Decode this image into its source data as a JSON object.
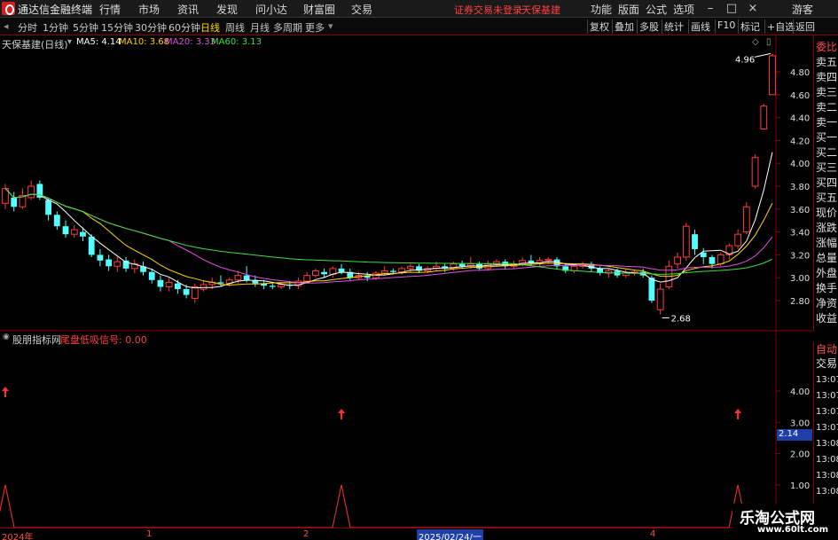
{
  "titlebar": {
    "app_title": "通达信金融终端",
    "menu": [
      "行情",
      "市场",
      "资讯",
      "发现",
      "问小达",
      "财富圈",
      "交易"
    ],
    "warning": "证券交易未登录",
    "stock_name": "天保基建",
    "right_menu": [
      "功能",
      "版面",
      "公式",
      "选项"
    ],
    "user": "游客",
    "min_icon": "minimize-icon",
    "max_icon": "maximize-icon",
    "close_icon": "close-icon"
  },
  "periodbar": {
    "periods": [
      "分时",
      "1分钟",
      "5分钟",
      "15分钟",
      "30分钟",
      "60分钟",
      "日线",
      "周线",
      "月线",
      "多周期",
      "更多"
    ],
    "active": "日线",
    "tools": [
      "复权",
      "叠加",
      "多股",
      "统计",
      "画线",
      "F10",
      "标记",
      "+自选",
      "返回"
    ]
  },
  "main_chart": {
    "header_name": "天保基建",
    "header_period": "(日线)",
    "ma": [
      {
        "label": "MA5: 4.14",
        "color": "#ffffff"
      },
      {
        "label": "MA10: 3.68",
        "color": "#ffd700"
      },
      {
        "label": "MA20: 3.33",
        "color": "#e050e0"
      },
      {
        "label": "MA60: 3.13",
        "color": "#40e040"
      }
    ],
    "high_label": "4.96",
    "low_label": "2.68",
    "y_ticks": [
      "4.80",
      "4.60",
      "4.40",
      "4.20",
      "4.00",
      "3.80",
      "3.60",
      "3.40",
      "3.20",
      "3.00",
      "2.80"
    ]
  },
  "indicator": {
    "name": "股朋指标网",
    "signal_label": "尾盘低吸信号: 0.00",
    "value_badge": "2.14",
    "y_ticks": [
      "4.00",
      "3.00",
      "2.00",
      "1.00"
    ]
  },
  "side_panel": {
    "rows": [
      "委比",
      "卖五",
      "卖四",
      "卖三",
      "卖二",
      "卖一",
      "买一",
      "买二",
      "买三",
      "买四",
      "买五",
      "现价",
      "涨跌",
      "涨幅",
      "总量",
      "外盘",
      "换手",
      "净资",
      "收益"
    ],
    "bottom_rows": [
      "自动",
      "交易"
    ],
    "times": [
      "13:07",
      "13:07",
      "13:07",
      "13:07",
      "13:08",
      "13:08",
      "13:08",
      "13:08",
      "13:08"
    ],
    "top_label": "委比"
  },
  "timebar": {
    "ticks": [
      "2024年",
      "1",
      "2",
      "2025/02/24/一",
      "4"
    ]
  },
  "watermark": {
    "text": "乐淘公式网",
    "url": "www.60lt.com"
  },
  "chart_data": {
    "type": "candlestick",
    "title": "天保基建 (日线)",
    "ylim": [
      2.6,
      5.0
    ],
    "candles": [
      {
        "o": 3.65,
        "c": 3.78,
        "h": 3.82,
        "l": 3.6
      },
      {
        "o": 3.7,
        "c": 3.62,
        "h": 3.75,
        "l": 3.58
      },
      {
        "o": 3.62,
        "c": 3.72,
        "h": 3.78,
        "l": 3.6
      },
      {
        "o": 3.7,
        "c": 3.8,
        "h": 3.85,
        "l": 3.68
      },
      {
        "o": 3.82,
        "c": 3.7,
        "h": 3.85,
        "l": 3.68
      },
      {
        "o": 3.68,
        "c": 3.55,
        "h": 3.7,
        "l": 3.5
      },
      {
        "o": 3.55,
        "c": 3.45,
        "h": 3.58,
        "l": 3.42
      },
      {
        "o": 3.45,
        "c": 3.38,
        "h": 3.5,
        "l": 3.35
      },
      {
        "o": 3.38,
        "c": 3.42,
        "h": 3.46,
        "l": 3.35
      },
      {
        "o": 3.4,
        "c": 3.36,
        "h": 3.44,
        "l": 3.32
      },
      {
        "o": 3.36,
        "c": 3.2,
        "h": 3.38,
        "l": 3.18
      },
      {
        "o": 3.2,
        "c": 3.15,
        "h": 3.25,
        "l": 3.1
      },
      {
        "o": 3.16,
        "c": 3.1,
        "h": 3.2,
        "l": 3.06
      },
      {
        "o": 3.1,
        "c": 3.14,
        "h": 3.18,
        "l": 3.05
      },
      {
        "o": 3.15,
        "c": 3.08,
        "h": 3.18,
        "l": 3.05
      },
      {
        "o": 3.08,
        "c": 3.12,
        "h": 3.16,
        "l": 3.04
      },
      {
        "o": 3.1,
        "c": 3.05,
        "h": 3.14,
        "l": 3.02
      },
      {
        "o": 3.05,
        "c": 2.98,
        "h": 3.08,
        "l": 2.95
      },
      {
        "o": 2.98,
        "c": 2.92,
        "h": 3.02,
        "l": 2.88
      },
      {
        "o": 2.92,
        "c": 2.96,
        "h": 3.0,
        "l": 2.88
      },
      {
        "o": 2.95,
        "c": 2.9,
        "h": 2.98,
        "l": 2.86
      },
      {
        "o": 2.9,
        "c": 2.85,
        "h": 2.94,
        "l": 2.82
      },
      {
        "o": 2.82,
        "c": 2.92,
        "h": 2.95,
        "l": 2.78
      },
      {
        "o": 2.9,
        "c": 2.94,
        "h": 2.98,
        "l": 2.88
      },
      {
        "o": 2.94,
        "c": 2.96,
        "h": 3.0,
        "l": 2.9
      },
      {
        "o": 2.96,
        "c": 2.95,
        "h": 3.02,
        "l": 2.92
      },
      {
        "o": 2.95,
        "c": 2.98,
        "h": 3.0,
        "l": 2.92
      },
      {
        "o": 2.98,
        "c": 3.02,
        "h": 3.06,
        "l": 2.95
      },
      {
        "o": 3.02,
        "c": 2.98,
        "h": 3.1,
        "l": 2.96
      },
      {
        "o": 2.98,
        "c": 2.95,
        "h": 3.02,
        "l": 2.92
      },
      {
        "o": 2.95,
        "c": 2.93,
        "h": 2.98,
        "l": 2.9
      },
      {
        "o": 2.93,
        "c": 2.92,
        "h": 2.96,
        "l": 2.9
      },
      {
        "o": 2.92,
        "c": 2.94,
        "h": 2.96,
        "l": 2.9
      },
      {
        "o": 2.94,
        "c": 2.93,
        "h": 2.97,
        "l": 2.9
      },
      {
        "o": 2.93,
        "c": 2.97,
        "h": 3.0,
        "l": 2.9
      },
      {
        "o": 2.97,
        "c": 3.02,
        "h": 3.05,
        "l": 2.95
      },
      {
        "o": 3.02,
        "c": 3.06,
        "h": 3.08,
        "l": 3.0
      },
      {
        "o": 3.05,
        "c": 3.03,
        "h": 3.08,
        "l": 3.0
      },
      {
        "o": 3.03,
        "c": 3.08,
        "h": 3.1,
        "l": 3.0
      },
      {
        "o": 3.08,
        "c": 3.05,
        "h": 3.12,
        "l": 3.03
      },
      {
        "o": 3.05,
        "c": 3.0,
        "h": 3.08,
        "l": 2.98
      },
      {
        "o": 3.0,
        "c": 3.02,
        "h": 3.05,
        "l": 2.98
      },
      {
        "o": 3.02,
        "c": 3.0,
        "h": 3.05,
        "l": 2.97
      },
      {
        "o": 3.0,
        "c": 3.04,
        "h": 3.06,
        "l": 2.98
      },
      {
        "o": 3.04,
        "c": 3.06,
        "h": 3.1,
        "l": 3.02
      },
      {
        "o": 3.06,
        "c": 3.05,
        "h": 3.08,
        "l": 3.03
      },
      {
        "o": 3.05,
        "c": 3.08,
        "h": 3.1,
        "l": 3.03
      },
      {
        "o": 3.08,
        "c": 3.1,
        "h": 3.12,
        "l": 3.05
      },
      {
        "o": 3.1,
        "c": 3.06,
        "h": 3.12,
        "l": 3.04
      },
      {
        "o": 3.06,
        "c": 3.08,
        "h": 3.1,
        "l": 3.04
      },
      {
        "o": 3.08,
        "c": 3.1,
        "h": 3.14,
        "l": 3.06
      },
      {
        "o": 3.1,
        "c": 3.08,
        "h": 3.12,
        "l": 3.05
      },
      {
        "o": 3.08,
        "c": 3.12,
        "h": 3.14,
        "l": 3.06
      },
      {
        "o": 3.12,
        "c": 3.1,
        "h": 3.15,
        "l": 3.08
      },
      {
        "o": 3.1,
        "c": 3.12,
        "h": 3.18,
        "l": 3.08
      },
      {
        "o": 3.12,
        "c": 3.08,
        "h": 3.14,
        "l": 3.06
      },
      {
        "o": 3.08,
        "c": 3.12,
        "h": 3.15,
        "l": 3.06
      },
      {
        "o": 3.12,
        "c": 3.14,
        "h": 3.16,
        "l": 3.1
      },
      {
        "o": 3.14,
        "c": 3.1,
        "h": 3.16,
        "l": 3.08
      },
      {
        "o": 3.1,
        "c": 3.12,
        "h": 3.15,
        "l": 3.08
      },
      {
        "o": 3.12,
        "c": 3.15,
        "h": 3.18,
        "l": 3.1
      },
      {
        "o": 3.15,
        "c": 3.13,
        "h": 3.2,
        "l": 3.1
      },
      {
        "o": 3.13,
        "c": 3.15,
        "h": 3.18,
        "l": 3.1
      },
      {
        "o": 3.15,
        "c": 3.16,
        "h": 3.18,
        "l": 3.12
      },
      {
        "o": 3.16,
        "c": 3.1,
        "h": 3.18,
        "l": 3.08
      },
      {
        "o": 3.1,
        "c": 3.06,
        "h": 3.12,
        "l": 3.04
      },
      {
        "o": 3.06,
        "c": 3.1,
        "h": 3.12,
        "l": 3.04
      },
      {
        "o": 3.1,
        "c": 3.12,
        "h": 3.14,
        "l": 3.08
      },
      {
        "o": 3.12,
        "c": 3.08,
        "h": 3.14,
        "l": 3.05
      },
      {
        "o": 3.08,
        "c": 3.04,
        "h": 3.1,
        "l": 3.02
      },
      {
        "o": 3.04,
        "c": 3.06,
        "h": 3.08,
        "l": 3.0
      },
      {
        "o": 3.06,
        "c": 3.02,
        "h": 3.08,
        "l": 3.0
      },
      {
        "o": 3.02,
        "c": 3.04,
        "h": 3.08,
        "l": 3.0
      },
      {
        "o": 3.04,
        "c": 3.05,
        "h": 3.07,
        "l": 3.02
      },
      {
        "o": 3.05,
        "c": 3.02,
        "h": 3.08,
        "l": 3.0
      },
      {
        "o": 3.0,
        "c": 2.8,
        "h": 3.02,
        "l": 2.78
      },
      {
        "o": 2.72,
        "c": 2.9,
        "h": 2.95,
        "l": 2.68
      },
      {
        "o": 2.92,
        "c": 3.1,
        "h": 3.15,
        "l": 2.9
      },
      {
        "o": 3.12,
        "c": 3.18,
        "h": 3.22,
        "l": 3.08
      },
      {
        "o": 3.18,
        "c": 3.45,
        "h": 3.48,
        "l": 3.15
      },
      {
        "o": 3.38,
        "c": 3.25,
        "h": 3.42,
        "l": 3.2
      },
      {
        "o": 3.22,
        "c": 3.18,
        "h": 3.26,
        "l": 3.12
      },
      {
        "o": 3.18,
        "c": 3.12,
        "h": 3.2,
        "l": 3.08
      },
      {
        "o": 3.12,
        "c": 3.2,
        "h": 3.22,
        "l": 3.1
      },
      {
        "o": 3.2,
        "c": 3.28,
        "h": 3.3,
        "l": 3.16
      },
      {
        "o": 3.28,
        "c": 3.38,
        "h": 3.42,
        "l": 3.25
      },
      {
        "o": 3.4,
        "c": 3.62,
        "h": 3.66,
        "l": 3.38
      },
      {
        "o": 3.8,
        "c": 4.05,
        "h": 4.08,
        "l": 3.78
      },
      {
        "o": 4.3,
        "c": 4.5,
        "h": 4.52,
        "l": 4.3
      },
      {
        "o": 4.6,
        "c": 4.94,
        "h": 4.96,
        "l": 4.6
      }
    ],
    "signal": [
      {
        "index": 0,
        "value": 1
      },
      {
        "index": 39,
        "value": 1
      },
      {
        "index": 85,
        "value": 1
      }
    ]
  }
}
